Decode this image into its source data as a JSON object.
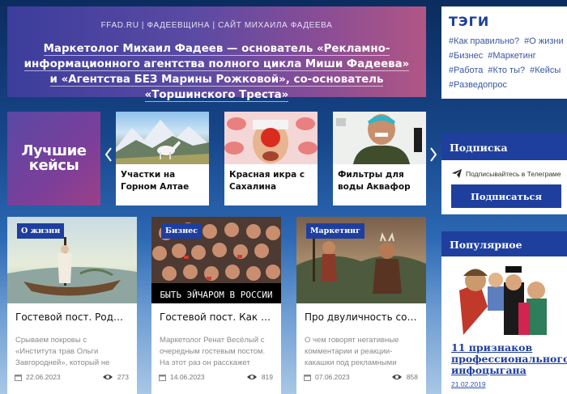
{
  "hero": {
    "kicker": "FFAD.RU | ФАДЕЕВЩИНА | САЙТ МИХАИЛА ФАДЕЕВА",
    "title": "Маркетолог Михаил Фадеев — основатель «Рекламно-информационного агентства полного цикла Миши Фадеева» и «Агентства БЕЗ Марины Рожковой», со-основатель «Торшинского Треста»"
  },
  "tags": {
    "title": "ТЭГИ",
    "items": [
      "#Как правильно?",
      "#О жизни",
      "#Бизнес",
      "#Маркетинг",
      "#Работа",
      "#Кто ты?",
      "#Кейсы",
      "#Разведопрос"
    ]
  },
  "cases": {
    "banner": "Лучшие кейсы",
    "prev_icon": "chevron-left-icon",
    "next_icon": "chevron-right-icon",
    "items": [
      {
        "title": "Участки на Горном Алтае"
      },
      {
        "title": "Красная икра с Сахалина"
      },
      {
        "title": "Фильтры для воды Аквафор"
      }
    ]
  },
  "subscribe": {
    "title": "Подписка",
    "telegram_text": "Подписывайтесь в Телеграме",
    "button": "Подписаться"
  },
  "popular": {
    "title": "Популярное",
    "item_title": "11 признаков профессионального инфоцыгана",
    "item_date": "21.02.2019"
  },
  "posts": [
    {
      "badge": "О жизни",
      "title": "Гостевой пост. Роднов...",
      "excerpt": "Срываем покровы с «Института трав Ольги Завгородней», который не только занимается",
      "date": "22.06.2023",
      "views": "273"
    },
    {
      "badge": "Бизнес",
      "title": "Гостевой пост. Как шт...",
      "excerpt": "Маркетолог Ренат Весёлый с очередным гостевым постом. На этот раз он расскажет истории",
      "date": "14.06.2023",
      "views": "819",
      "image_caption": "БЫТЬ ЭЙЧАРОМ В РОССИИ"
    },
    {
      "badge": "Маркетинг",
      "title": "Про двуличность соврем...",
      "excerpt": "О чем говорят негативные комментарии и реакции-какашки под рекламными",
      "date": "07.06.2023",
      "views": "858"
    }
  ]
}
